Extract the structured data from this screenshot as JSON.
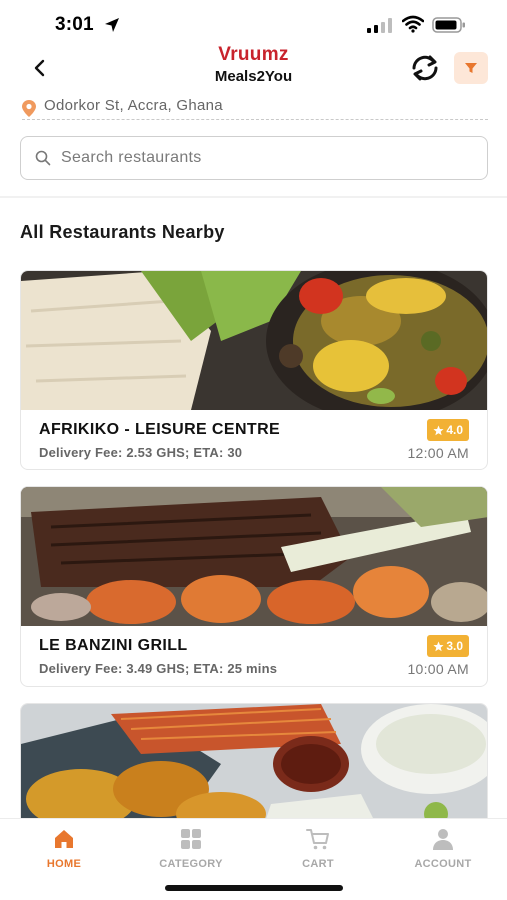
{
  "status_bar": {
    "time": "3:01"
  },
  "header": {
    "brand_name": "Vruumz",
    "brand_sub": "Meals2You",
    "accent_color": "#c8232c",
    "filter_accent": "#e8772e"
  },
  "address": {
    "text": "Odorkor St, Accra, Ghana"
  },
  "search": {
    "placeholder": "Search restaurants",
    "value": ""
  },
  "section": {
    "title": "All Restaurants Nearby"
  },
  "restaurants": [
    {
      "name": "AFRIKIKO - LEISURE CENTRE",
      "meta": "Delivery Fee: 2.53 GHS; ETA: 30",
      "rating": "4.0",
      "time": "12:00 AM"
    },
    {
      "name": "LE BANZINI GRILL",
      "meta": "Delivery Fee: 3.49 GHS; ETA: 25 mins",
      "rating": "3.0",
      "time": "10:00 AM"
    },
    {
      "name": "",
      "meta": "",
      "rating": "",
      "time": ""
    }
  ],
  "bottom_nav": {
    "home": "HOME",
    "category": "CATEGORY",
    "cart": "CART",
    "account": "ACCOUNT",
    "active": "home"
  },
  "icons": [
    "location-arrow-icon",
    "signal-icon",
    "wifi-icon",
    "battery-icon",
    "back-chevron-icon",
    "refresh-icon",
    "filter-icon",
    "location-pin-icon",
    "search-icon",
    "star-icon",
    "home-icon",
    "category-grid-icon",
    "cart-icon",
    "account-icon"
  ]
}
